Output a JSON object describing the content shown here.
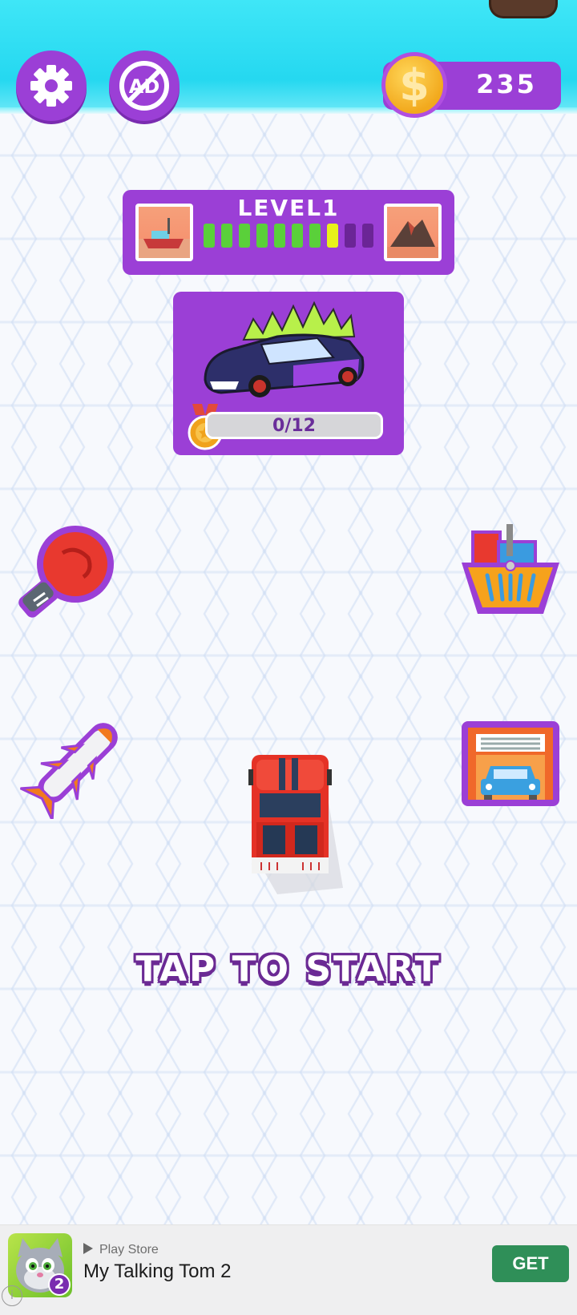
{
  "hud": {
    "coins": "235",
    "coin_symbol": "$",
    "settings_icon": "gear-icon",
    "no_ads_icon": "no-ads-icon",
    "no_ads_label": "AD"
  },
  "level": {
    "title": "LEVEL1",
    "segments_total": 10,
    "segments_completed": 7,
    "current_segment": 8
  },
  "car_unlock": {
    "progress_text": "0/12",
    "progress": 0
  },
  "side_buttons": {
    "left": [
      "boxing-glove-icon",
      "rocket-icon"
    ],
    "right": [
      "shop-basket-icon",
      "garage-icon"
    ]
  },
  "prompt": "TAP TO START",
  "ad": {
    "store_label": "Play Store",
    "title": "My Talking Tom 2",
    "cta": "GET",
    "badge": "2",
    "info": "i"
  },
  "colors": {
    "accent_purple": "#9b3fd6",
    "water": "#25d8f0",
    "progress_done": "#5ad03a",
    "progress_current": "#e8f21a",
    "ad_cta": "#2f8f58"
  }
}
